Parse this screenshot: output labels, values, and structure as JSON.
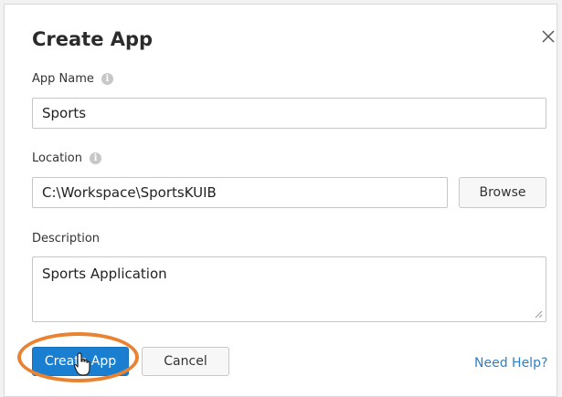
{
  "dialog": {
    "title": "Create App",
    "close_icon": "close-icon"
  },
  "form": {
    "app_name": {
      "label": "App Name",
      "value": "Sports",
      "info_icon": "info-icon"
    },
    "location": {
      "label": "Location",
      "value": "C:\\Workspace\\SportsKUIB",
      "info_icon": "info-icon",
      "browse_label": "Browse"
    },
    "description": {
      "label": "Description",
      "value": "Sports Application"
    }
  },
  "footer": {
    "create_label": "Create App",
    "cancel_label": "Cancel",
    "help_label": "Need Help?"
  },
  "colors": {
    "primary": "#1a7fd0",
    "highlight": "#e98332",
    "link": "#2f7fc8"
  }
}
